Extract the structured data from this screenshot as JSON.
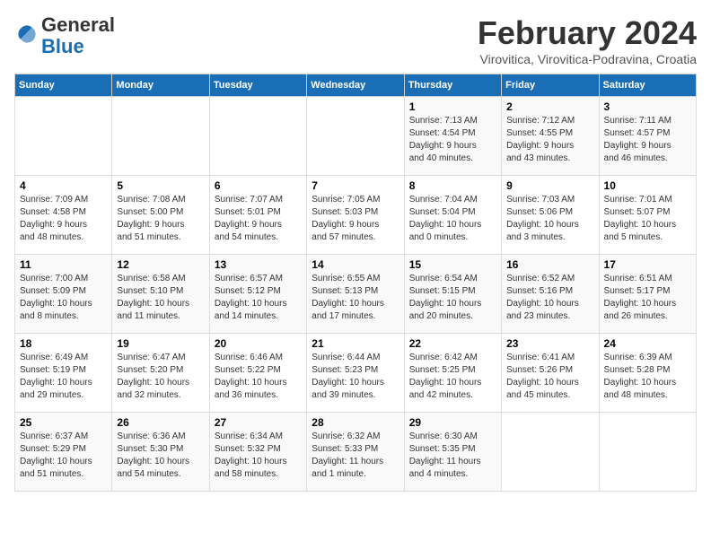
{
  "logo": {
    "general": "General",
    "blue": "Blue"
  },
  "header": {
    "month": "February 2024",
    "location": "Virovitica, Virovitica-Podravina, Croatia"
  },
  "weekdays": [
    "Sunday",
    "Monday",
    "Tuesday",
    "Wednesday",
    "Thursday",
    "Friday",
    "Saturday"
  ],
  "weeks": [
    [
      {
        "day": "",
        "info": ""
      },
      {
        "day": "",
        "info": ""
      },
      {
        "day": "",
        "info": ""
      },
      {
        "day": "",
        "info": ""
      },
      {
        "day": "1",
        "info": "Sunrise: 7:13 AM\nSunset: 4:54 PM\nDaylight: 9 hours\nand 40 minutes."
      },
      {
        "day": "2",
        "info": "Sunrise: 7:12 AM\nSunset: 4:55 PM\nDaylight: 9 hours\nand 43 minutes."
      },
      {
        "day": "3",
        "info": "Sunrise: 7:11 AM\nSunset: 4:57 PM\nDaylight: 9 hours\nand 46 minutes."
      }
    ],
    [
      {
        "day": "4",
        "info": "Sunrise: 7:09 AM\nSunset: 4:58 PM\nDaylight: 9 hours\nand 48 minutes."
      },
      {
        "day": "5",
        "info": "Sunrise: 7:08 AM\nSunset: 5:00 PM\nDaylight: 9 hours\nand 51 minutes."
      },
      {
        "day": "6",
        "info": "Sunrise: 7:07 AM\nSunset: 5:01 PM\nDaylight: 9 hours\nand 54 minutes."
      },
      {
        "day": "7",
        "info": "Sunrise: 7:05 AM\nSunset: 5:03 PM\nDaylight: 9 hours\nand 57 minutes."
      },
      {
        "day": "8",
        "info": "Sunrise: 7:04 AM\nSunset: 5:04 PM\nDaylight: 10 hours\nand 0 minutes."
      },
      {
        "day": "9",
        "info": "Sunrise: 7:03 AM\nSunset: 5:06 PM\nDaylight: 10 hours\nand 3 minutes."
      },
      {
        "day": "10",
        "info": "Sunrise: 7:01 AM\nSunset: 5:07 PM\nDaylight: 10 hours\nand 5 minutes."
      }
    ],
    [
      {
        "day": "11",
        "info": "Sunrise: 7:00 AM\nSunset: 5:09 PM\nDaylight: 10 hours\nand 8 minutes."
      },
      {
        "day": "12",
        "info": "Sunrise: 6:58 AM\nSunset: 5:10 PM\nDaylight: 10 hours\nand 11 minutes."
      },
      {
        "day": "13",
        "info": "Sunrise: 6:57 AM\nSunset: 5:12 PM\nDaylight: 10 hours\nand 14 minutes."
      },
      {
        "day": "14",
        "info": "Sunrise: 6:55 AM\nSunset: 5:13 PM\nDaylight: 10 hours\nand 17 minutes."
      },
      {
        "day": "15",
        "info": "Sunrise: 6:54 AM\nSunset: 5:15 PM\nDaylight: 10 hours\nand 20 minutes."
      },
      {
        "day": "16",
        "info": "Sunrise: 6:52 AM\nSunset: 5:16 PM\nDaylight: 10 hours\nand 23 minutes."
      },
      {
        "day": "17",
        "info": "Sunrise: 6:51 AM\nSunset: 5:17 PM\nDaylight: 10 hours\nand 26 minutes."
      }
    ],
    [
      {
        "day": "18",
        "info": "Sunrise: 6:49 AM\nSunset: 5:19 PM\nDaylight: 10 hours\nand 29 minutes."
      },
      {
        "day": "19",
        "info": "Sunrise: 6:47 AM\nSunset: 5:20 PM\nDaylight: 10 hours\nand 32 minutes."
      },
      {
        "day": "20",
        "info": "Sunrise: 6:46 AM\nSunset: 5:22 PM\nDaylight: 10 hours\nand 36 minutes."
      },
      {
        "day": "21",
        "info": "Sunrise: 6:44 AM\nSunset: 5:23 PM\nDaylight: 10 hours\nand 39 minutes."
      },
      {
        "day": "22",
        "info": "Sunrise: 6:42 AM\nSunset: 5:25 PM\nDaylight: 10 hours\nand 42 minutes."
      },
      {
        "day": "23",
        "info": "Sunrise: 6:41 AM\nSunset: 5:26 PM\nDaylight: 10 hours\nand 45 minutes."
      },
      {
        "day": "24",
        "info": "Sunrise: 6:39 AM\nSunset: 5:28 PM\nDaylight: 10 hours\nand 48 minutes."
      }
    ],
    [
      {
        "day": "25",
        "info": "Sunrise: 6:37 AM\nSunset: 5:29 PM\nDaylight: 10 hours\nand 51 minutes."
      },
      {
        "day": "26",
        "info": "Sunrise: 6:36 AM\nSunset: 5:30 PM\nDaylight: 10 hours\nand 54 minutes."
      },
      {
        "day": "27",
        "info": "Sunrise: 6:34 AM\nSunset: 5:32 PM\nDaylight: 10 hours\nand 58 minutes."
      },
      {
        "day": "28",
        "info": "Sunrise: 6:32 AM\nSunset: 5:33 PM\nDaylight: 11 hours\nand 1 minute."
      },
      {
        "day": "29",
        "info": "Sunrise: 6:30 AM\nSunset: 5:35 PM\nDaylight: 11 hours\nand 4 minutes."
      },
      {
        "day": "",
        "info": ""
      },
      {
        "day": "",
        "info": ""
      }
    ]
  ]
}
